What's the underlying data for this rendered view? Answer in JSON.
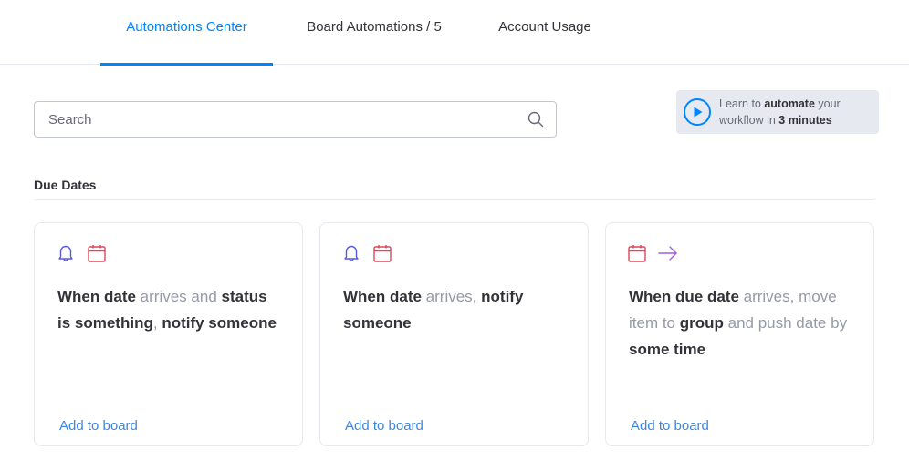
{
  "tabs": [
    {
      "label": "Automations Center",
      "active": true
    },
    {
      "label": "Board Automations / 5",
      "active": false
    },
    {
      "label": "Account Usage",
      "active": false
    }
  ],
  "search": {
    "placeholder": "Search",
    "value": "",
    "icon": "search-icon"
  },
  "promo": {
    "icon": "play-circle-icon",
    "part1": "Learn to ",
    "bold1": "automate",
    "part2": " your workflow in ",
    "bold2": "3 minutes"
  },
  "section": {
    "title": "Due Dates"
  },
  "colors": {
    "accent": "#0085ff",
    "bell": "#5559df",
    "calendar": "#e2445c",
    "arrow": "#a25ddc",
    "link": "#3c86e0"
  },
  "cards": [
    {
      "icons": [
        "bell-icon",
        "calendar-icon"
      ],
      "segments": [
        {
          "t": "When date",
          "b": true
        },
        {
          "t": " arrives and ",
          "b": false
        },
        {
          "t": "status is something",
          "b": true
        },
        {
          "t": ", ",
          "b": false
        },
        {
          "t": "notify someone",
          "b": true
        }
      ],
      "action": "Add to board"
    },
    {
      "icons": [
        "bell-icon",
        "calendar-icon"
      ],
      "segments": [
        {
          "t": "When date",
          "b": true
        },
        {
          "t": " arrives, ",
          "b": false
        },
        {
          "t": "notify someone",
          "b": true
        }
      ],
      "action": "Add to board"
    },
    {
      "icons": [
        "calendar-icon",
        "arrow-right-icon"
      ],
      "segments": [
        {
          "t": "When due date",
          "b": true
        },
        {
          "t": " arrives, move item to ",
          "b": false
        },
        {
          "t": "group",
          "b": true
        },
        {
          "t": " and push date by ",
          "b": false
        },
        {
          "t": "some time",
          "b": true
        }
      ],
      "action": "Add to board"
    }
  ]
}
